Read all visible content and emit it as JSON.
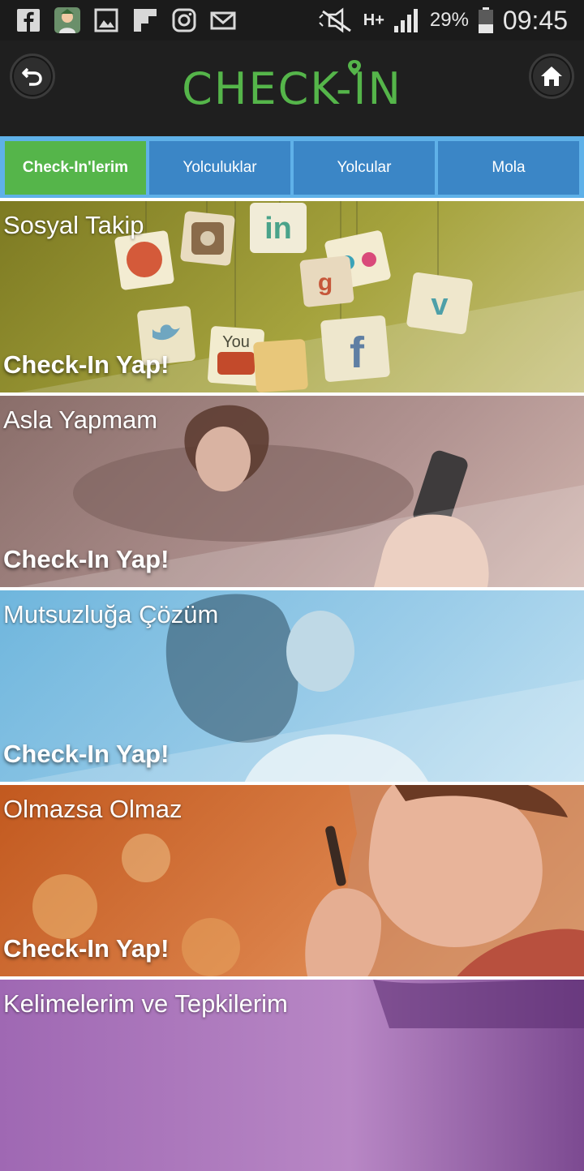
{
  "status_bar": {
    "battery_percent": "29%",
    "time": "09:45",
    "network": "H+",
    "icons": [
      "facebook-icon",
      "avatar-icon",
      "gallery-icon",
      "flipboard-icon",
      "instagram-icon",
      "mail-icon",
      "mute-icon",
      "signal-icon",
      "battery-icon"
    ]
  },
  "header": {
    "logo_text": "CHECK-IN",
    "back_icon": "back-arrow-icon",
    "home_icon": "home-icon",
    "brand_color": "#55b54a"
  },
  "tabs": [
    {
      "label": "Check-In'lerim",
      "active": true
    },
    {
      "label": "Yolculuklar",
      "active": false
    },
    {
      "label": "Yolcular",
      "active": false
    },
    {
      "label": "Mola",
      "active": false
    }
  ],
  "cards": [
    {
      "title": "Sosyal Takip",
      "cta": "Check-In Yap!"
    },
    {
      "title": "Asla Yapmam",
      "cta": "Check-In Yap!"
    },
    {
      "title": "Mutsuzluğa Çözüm",
      "cta": "Check-In Yap!"
    },
    {
      "title": "Olmazsa Olmaz",
      "cta": "Check-In Yap!"
    },
    {
      "title": "Kelimelerim ve Tepkilerim"
    }
  ],
  "colors": {
    "tab_active": "#55b54a",
    "tab_inactive": "#3b86c6",
    "tab_bar": "#5fb1e8",
    "header_bg": "#1f1f1f"
  }
}
